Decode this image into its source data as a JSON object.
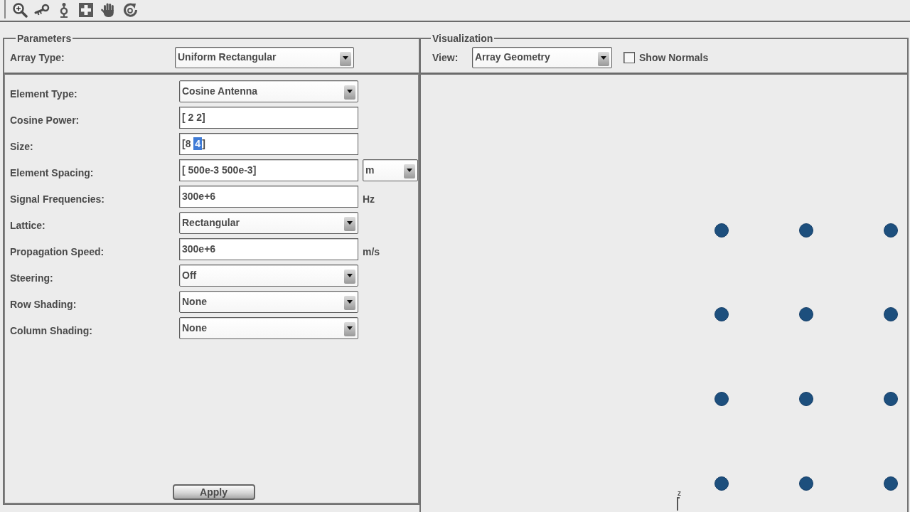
{
  "parameters": {
    "title": "Parameters",
    "array_type": {
      "label": "Array Type:",
      "value": "Uniform Rectangular"
    },
    "fields": [
      {
        "label": "Element Type:",
        "kind": "dropdown",
        "value": "Cosine Antenna"
      },
      {
        "label": "Cosine Power:",
        "kind": "text",
        "segments": [
          {
            "text": "[ 2 2]",
            "selected": false
          }
        ]
      },
      {
        "label": "Size:",
        "kind": "text",
        "segments": [
          {
            "text": "[8 ",
            "selected": false
          },
          {
            "text": "4",
            "selected": true
          },
          {
            "text": "]",
            "selected": false
          }
        ]
      },
      {
        "label": "Element Spacing:",
        "kind": "text",
        "segments": [
          {
            "text": "[ 500e-3 500e-3]",
            "selected": false
          }
        ],
        "unit": {
          "kind": "dropdown",
          "value": "m"
        }
      },
      {
        "label": "Signal Frequencies:",
        "kind": "text",
        "segments": [
          {
            "text": "300e+6",
            "selected": false
          }
        ],
        "unit": {
          "kind": "label",
          "value": "Hz"
        }
      },
      {
        "label": "Lattice:",
        "kind": "dropdown",
        "value": "Rectangular"
      },
      {
        "label": "Propagation Speed:",
        "kind": "text",
        "segments": [
          {
            "text": "300e+6",
            "selected": false
          }
        ],
        "unit": {
          "kind": "label",
          "value": "m/s"
        }
      },
      {
        "label": "Steering:",
        "kind": "dropdown",
        "value": "Off"
      },
      {
        "label": "Row Shading:",
        "kind": "dropdown",
        "value": "None"
      },
      {
        "label": "Column Shading:",
        "kind": "dropdown",
        "value": "None"
      }
    ],
    "apply_button": "Apply"
  },
  "visualization": {
    "title": "Visualization",
    "view": {
      "label": "View:",
      "value": "Array Geometry"
    },
    "show_normals": {
      "label": "Show Normals",
      "checked": false
    },
    "plot": {
      "axis_label": "z"
    }
  }
}
